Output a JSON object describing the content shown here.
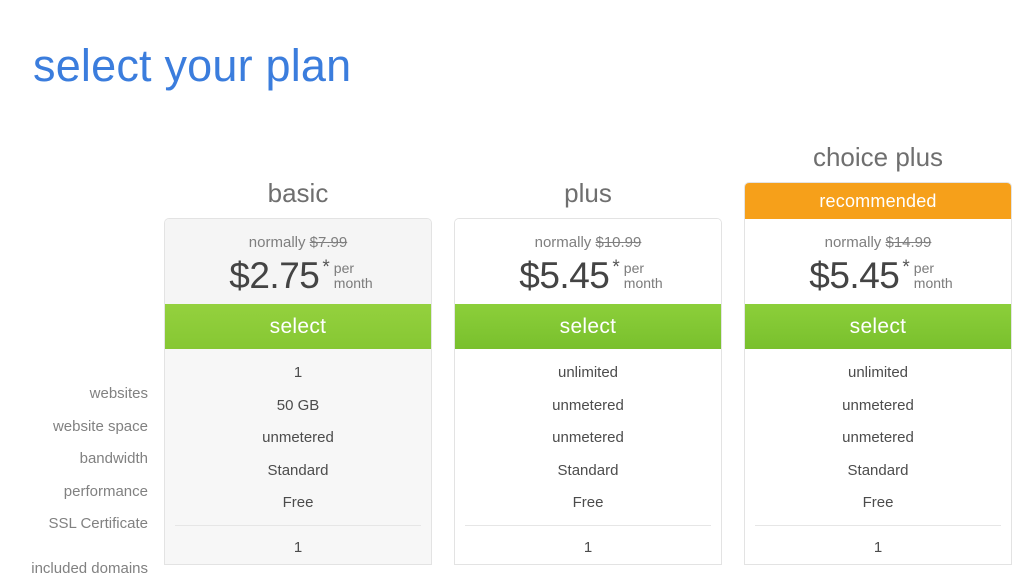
{
  "page": {
    "title": "select your plan"
  },
  "features": {
    "labels": [
      "websites",
      "website space",
      "bandwidth",
      "performance",
      "SSL Certificate",
      "included domains"
    ]
  },
  "colors": {
    "title_blue": "#3b7ddd",
    "select_green": "#79c02d",
    "recommended_orange": "#f6a01a",
    "basic_card_grey": "#f5f5f5"
  },
  "plans": [
    {
      "name": "basic",
      "ribbon": null,
      "normally_prefix": "normally ",
      "old_price": "$7.99",
      "price": "$2.75",
      "star": "*",
      "per": "per",
      "month": "month",
      "select_label": "select",
      "values": [
        "1",
        "50 GB",
        "unmetered",
        "Standard",
        "Free",
        "1"
      ]
    },
    {
      "name": "plus",
      "ribbon": null,
      "normally_prefix": "normally ",
      "old_price": "$10.99",
      "price": "$5.45",
      "star": "*",
      "per": "per",
      "month": "month",
      "select_label": "select",
      "values": [
        "unlimited",
        "unmetered",
        "unmetered",
        "Standard",
        "Free",
        "1"
      ]
    },
    {
      "name": "choice plus",
      "ribbon": "recommended",
      "normally_prefix": "normally ",
      "old_price": "$14.99",
      "price": "$5.45",
      "star": "*",
      "per": "per",
      "month": "month",
      "select_label": "select",
      "values": [
        "unlimited",
        "unmetered",
        "unmetered",
        "Standard",
        "Free",
        "1"
      ]
    }
  ]
}
